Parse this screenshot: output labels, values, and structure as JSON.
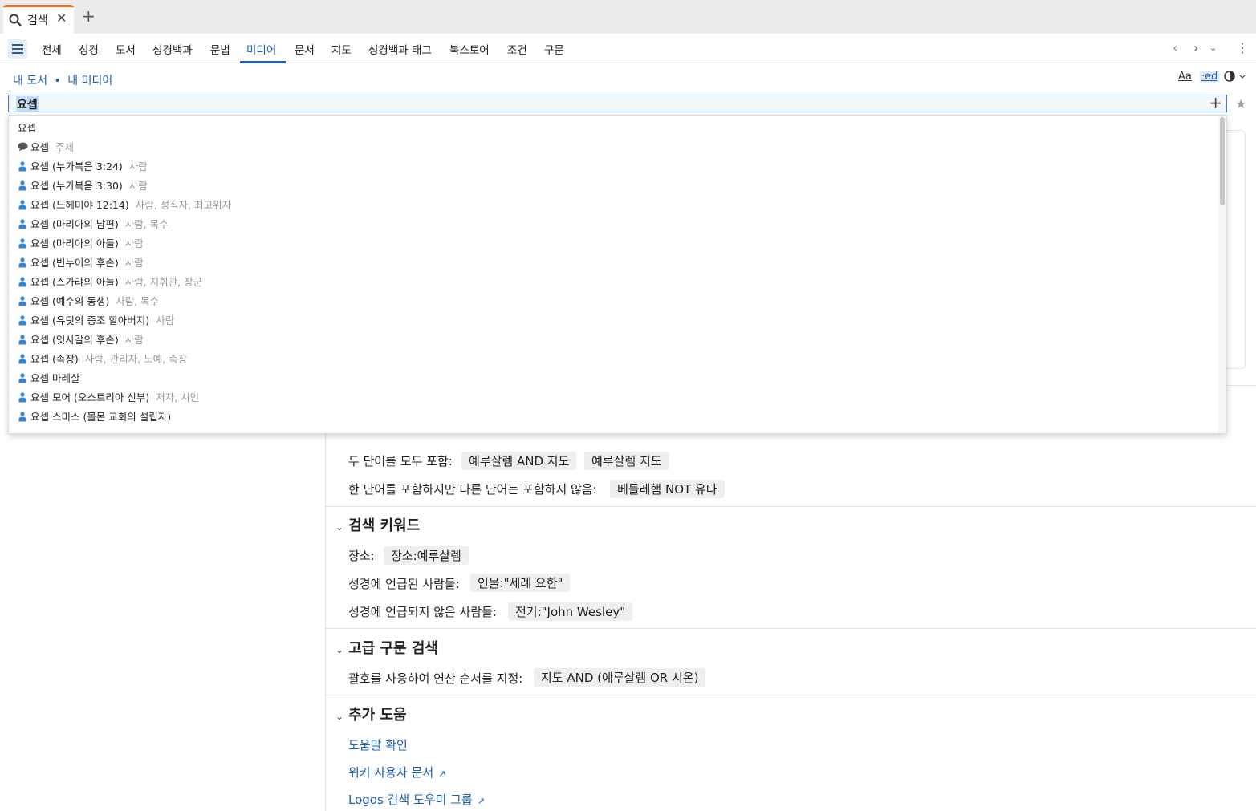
{
  "tab": {
    "label": "검색",
    "close": "✕",
    "new": "+"
  },
  "nav": {
    "items": [
      "전체",
      "성경",
      "도서",
      "성경백과",
      "문법",
      "미디어",
      "문서",
      "지도",
      "성경백과 태그",
      "북스토어",
      "조건",
      "구문"
    ],
    "active": "미디어"
  },
  "header": {
    "crumb1": "내 도서",
    "sep": "•",
    "crumb2": "내 미디어",
    "font_icon": "Aa",
    "ed_icon": "·ed"
  },
  "search": {
    "value": "요셉"
  },
  "dropdown": {
    "items": [
      {
        "icon": "",
        "label": "요셉",
        "category": ""
      },
      {
        "icon": "topic-icon",
        "label": "요셉",
        "category": "주제"
      },
      {
        "icon": "person-icon",
        "label": "요셉 (누가복음 3:24)",
        "category": "사람"
      },
      {
        "icon": "person-icon",
        "label": "요셉 (누가복음 3:30)",
        "category": "사람"
      },
      {
        "icon": "person-icon",
        "label": "요셉 (느헤미야 12:14)",
        "category": "사람, 성직자, 최고위자"
      },
      {
        "icon": "person-icon",
        "label": "요셉 (마리아의 남편)",
        "category": "사람, 목수"
      },
      {
        "icon": "person-icon",
        "label": "요셉 (마리아의 아들)",
        "category": "사람"
      },
      {
        "icon": "person-icon",
        "label": "요셉 (빈누이의 후손)",
        "category": "사람"
      },
      {
        "icon": "person-icon",
        "label": "요셉 (스가랴의 아들)",
        "category": "사람, 지휘관, 장군"
      },
      {
        "icon": "person-icon",
        "label": "요셉 (예수의 동생)",
        "category": "사람, 목수"
      },
      {
        "icon": "person-icon",
        "label": "요셉 (유딧의 증조 할아버지)",
        "category": "사람"
      },
      {
        "icon": "person-icon",
        "label": "요셉 (잇사갈의 후손)",
        "category": "사람"
      },
      {
        "icon": "person-icon",
        "label": "요셉 (족장)",
        "category": "사람, 관리자, 노예, 족장"
      },
      {
        "icon": "person-icon",
        "label": "요셉 마레샬",
        "category": ""
      },
      {
        "icon": "person-icon",
        "label": "요셉 모어 (오스트리아 신부)",
        "category": "저자, 시인"
      },
      {
        "icon": "person-icon",
        "label": "요셉 스미스 (몰몬 교회의 설립자)",
        "category": ""
      }
    ]
  },
  "content": {
    "both": {
      "label": "두 단어를 모두 포함:",
      "chips": [
        "예루살렘 AND 지도",
        "예루살렘 지도"
      ]
    },
    "not": {
      "label": "한 단어를 포함하지만 다른 단어는 포함하지 않음:",
      "chips": [
        "베들레햄 NOT 유다"
      ]
    },
    "keywords": {
      "title": "검색 키워드",
      "place": {
        "label": "장소:",
        "chip": "장소:예루살렘"
      },
      "people": {
        "label": "성경에 언급된 사람들:",
        "chip": "인물:\"세례 요한\""
      },
      "others": {
        "label": "성경에 언급되지 않은 사람들:",
        "chip": "전기:\"John Wesley\""
      }
    },
    "advanced": {
      "title": "고급 구문 검색",
      "paren": {
        "label": "괄호를 사용하여 연산 순서를 지정:",
        "chip": "지도 AND (예루살렘 OR 시온)"
      }
    },
    "help": {
      "title": "추가 도움",
      "links": [
        "도움말 확인",
        "위키 사용자 문서",
        "Logos 검색 도우미 그룹"
      ]
    }
  }
}
